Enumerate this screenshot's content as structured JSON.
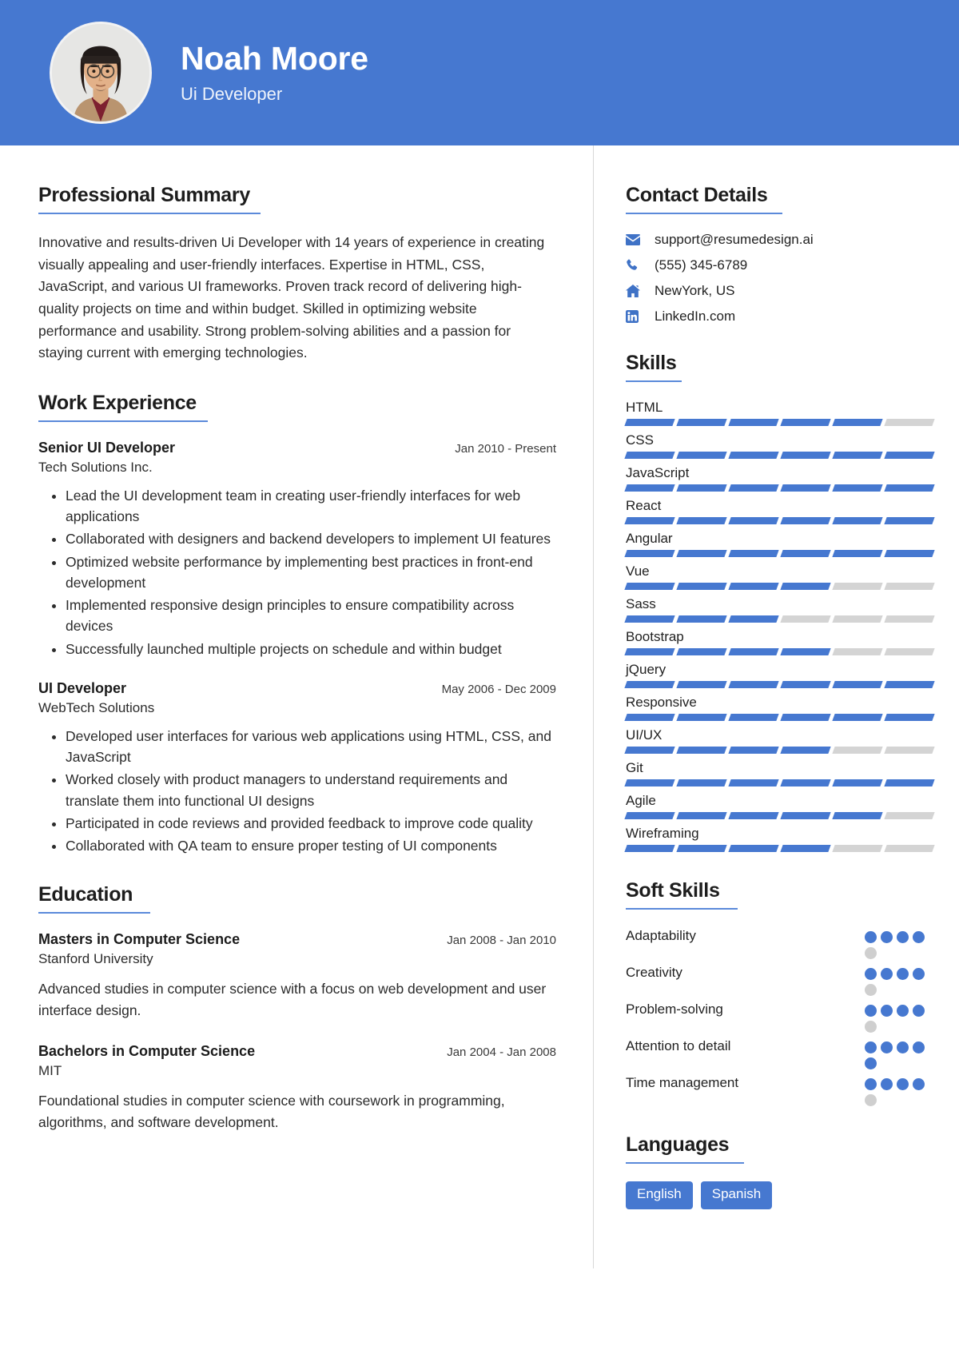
{
  "theme": {
    "accent": "#4678d0",
    "rule": "#5b8ada",
    "muted_bar": "#d4d4d4",
    "muted_dot": "#cfcfcf"
  },
  "header": {
    "name": "Noah Moore",
    "job_title": "Ui Developer",
    "avatar_alt": "portrait-photo"
  },
  "summary": {
    "heading": "Professional Summary",
    "text": "Innovative and results-driven Ui Developer with 14 years of experience in creating visually appealing and user-friendly interfaces. Expertise in HTML, CSS, JavaScript, and various UI frameworks. Proven track record of delivering high-quality projects on time and within budget. Skilled in optimizing website performance and usability. Strong problem-solving abilities and a passion for staying current with emerging technologies."
  },
  "work": {
    "heading": "Work Experience",
    "entries": [
      {
        "role": "Senior UI Developer",
        "date": "Jan 2010 - Present",
        "org": "Tech Solutions Inc.",
        "bullets": [
          "Lead the UI development team in creating user-friendly interfaces for web applications",
          "Collaborated with designers and backend developers to implement UI features",
          "Optimized website performance by implementing best practices in front-end development",
          "Implemented responsive design principles to ensure compatibility across devices",
          "Successfully launched multiple projects on schedule and within budget"
        ]
      },
      {
        "role": "UI Developer",
        "date": "May 2006 - Dec 2009",
        "org": "WebTech Solutions",
        "bullets": [
          "Developed user interfaces for various web applications using HTML, CSS, and JavaScript",
          "Worked closely with product managers to understand requirements and translate them into functional UI designs",
          "Participated in code reviews and provided feedback to improve code quality",
          "Collaborated with QA team to ensure proper testing of UI components"
        ]
      }
    ]
  },
  "education": {
    "heading": "Education",
    "entries": [
      {
        "degree": "Masters in Computer Science",
        "date": "Jan 2008 - Jan 2010",
        "school": "Stanford University",
        "desc": "Advanced studies in computer science with a focus on web development and user interface design."
      },
      {
        "degree": "Bachelors in Computer Science",
        "date": "Jan 2004 - Jan 2008",
        "school": "MIT",
        "desc": "Foundational studies in computer science with coursework in programming, algorithms, and software development."
      }
    ]
  },
  "contact": {
    "heading": "Contact Details",
    "items": [
      {
        "icon": "envelope-icon",
        "value": "support@resumedesign.ai"
      },
      {
        "icon": "phone-icon",
        "value": "(555) 345-6789"
      },
      {
        "icon": "home-icon",
        "value": "NewYork, US"
      },
      {
        "icon": "linkedin-icon",
        "value": "LinkedIn.com"
      }
    ]
  },
  "skills": {
    "heading": "Skills",
    "segments": 6,
    "items": [
      {
        "name": "HTML",
        "filled": 5
      },
      {
        "name": "CSS",
        "filled": 6
      },
      {
        "name": "JavaScript",
        "filled": 6
      },
      {
        "name": "React",
        "filled": 6
      },
      {
        "name": "Angular",
        "filled": 6
      },
      {
        "name": "Vue",
        "filled": 4
      },
      {
        "name": "Sass",
        "filled": 3
      },
      {
        "name": "Bootstrap",
        "filled": 4
      },
      {
        "name": "jQuery",
        "filled": 6
      },
      {
        "name": "Responsive",
        "filled": 6
      },
      {
        "name": "UI/UX",
        "filled": 4
      },
      {
        "name": "Git",
        "filled": 6
      },
      {
        "name": "Agile",
        "filled": 5
      },
      {
        "name": "Wireframing",
        "filled": 4
      }
    ]
  },
  "soft_skills": {
    "heading": "Soft Skills",
    "max": 5,
    "items": [
      {
        "name": "Adaptability",
        "filled": 4
      },
      {
        "name": "Creativity",
        "filled": 4
      },
      {
        "name": "Problem-solving",
        "filled": 4
      },
      {
        "name": "Attention to detail",
        "filled": 5
      },
      {
        "name": "Time management",
        "filled": 4
      }
    ]
  },
  "languages": {
    "heading": "Languages",
    "items": [
      "English",
      "Spanish"
    ]
  }
}
